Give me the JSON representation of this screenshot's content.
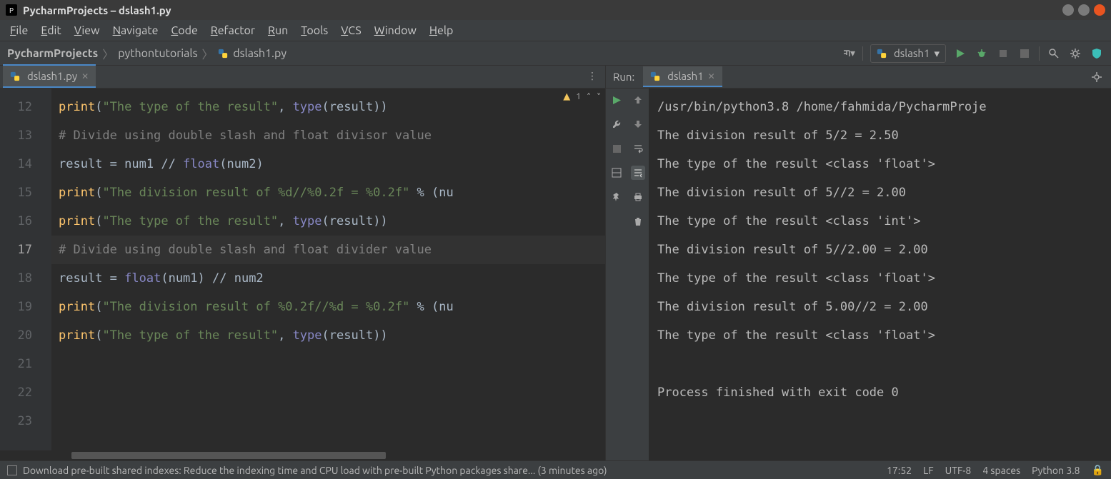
{
  "window": {
    "title": "PycharmProjects – dslash1.py"
  },
  "menu": {
    "items": [
      "File",
      "Edit",
      "View",
      "Navigate",
      "Code",
      "Refactor",
      "Run",
      "Tools",
      "VCS",
      "Window",
      "Help"
    ]
  },
  "breadcrumb": {
    "parts": [
      "PycharmProjects",
      "pythontutorials",
      "dslash1.py"
    ]
  },
  "run_config": {
    "selected": "dslash1"
  },
  "editor": {
    "tab": "dslash1.py",
    "warning_badge": "1",
    "lines": [
      {
        "n": "12",
        "tokens": [
          [
            "fn",
            "print"
          ],
          [
            "op",
            "("
          ],
          [
            "str",
            "\"The type of the result\""
          ],
          [
            "op",
            ", "
          ],
          [
            "builtin",
            "type"
          ],
          [
            "op",
            "("
          ],
          [
            "id",
            "result"
          ],
          [
            "op",
            "))"
          ]
        ]
      },
      {
        "n": "13",
        "tokens": [
          [
            "cmt",
            "# Divide using double slash and float divisor value"
          ]
        ]
      },
      {
        "n": "14",
        "tokens": [
          [
            "id",
            "result "
          ],
          [
            "op",
            "= "
          ],
          [
            "id",
            "num1 "
          ],
          [
            "op",
            "// "
          ],
          [
            "builtin",
            "float"
          ],
          [
            "op",
            "("
          ],
          [
            "id",
            "num2"
          ],
          [
            "op",
            ")"
          ]
        ]
      },
      {
        "n": "15",
        "tokens": [
          [
            "fn",
            "print"
          ],
          [
            "op",
            "("
          ],
          [
            "str",
            "\"The division result of %d//%0.2f = %0.2f\""
          ],
          [
            "op",
            " % ("
          ],
          [
            "id",
            "nu"
          ]
        ]
      },
      {
        "n": "16",
        "tokens": [
          [
            "fn",
            "print"
          ],
          [
            "op",
            "("
          ],
          [
            "str",
            "\"The type of the result\""
          ],
          [
            "op",
            ", "
          ],
          [
            "builtin",
            "type"
          ],
          [
            "op",
            "("
          ],
          [
            "id",
            "result"
          ],
          [
            "op",
            "))"
          ]
        ]
      },
      {
        "n": "17",
        "hl": true,
        "tokens": [
          [
            "cmt",
            "# Divide using double slash and float divider value"
          ]
        ]
      },
      {
        "n": "18",
        "tokens": [
          [
            "id",
            "result "
          ],
          [
            "op",
            "= "
          ],
          [
            "builtin",
            "float"
          ],
          [
            "op",
            "("
          ],
          [
            "id",
            "num1"
          ],
          [
            "op",
            ") // "
          ],
          [
            "id",
            "num2"
          ]
        ]
      },
      {
        "n": "19",
        "tokens": [
          [
            "fn",
            "print"
          ],
          [
            "op",
            "("
          ],
          [
            "str",
            "\"The division result of %0.2f//%d = %0.2f\""
          ],
          [
            "op",
            " % ("
          ],
          [
            "id",
            "nu"
          ]
        ]
      },
      {
        "n": "20",
        "tokens": [
          [
            "fn",
            "print"
          ],
          [
            "op",
            "("
          ],
          [
            "str",
            "\"The type of the result\""
          ],
          [
            "op",
            ", "
          ],
          [
            "builtin",
            "type"
          ],
          [
            "op",
            "("
          ],
          [
            "id",
            "result"
          ],
          [
            "op",
            "))"
          ]
        ]
      },
      {
        "n": "21",
        "tokens": []
      },
      {
        "n": "22",
        "tokens": []
      },
      {
        "n": "23",
        "tokens": []
      }
    ]
  },
  "run": {
    "label": "Run:",
    "tab": "dslash1",
    "output": [
      "/usr/bin/python3.8 /home/fahmida/PycharmProje",
      "The division result of 5/2 = 2.50",
      "The type of the result <class 'float'>",
      "The division result of 5//2 = 2.00",
      "The type of the result <class 'int'>",
      "The division result of 5//2.00 = 2.00",
      "The type of the result <class 'float'>",
      "The division result of 5.00//2 = 2.00",
      "The type of the result <class 'float'>",
      "",
      "Process finished with exit code 0"
    ]
  },
  "status": {
    "message": "Download pre-built shared indexes: Reduce the indexing time and CPU load with pre-built Python packages share... (3 minutes ago)",
    "time": "17:52",
    "line_ending": "LF",
    "encoding": "UTF-8",
    "indent": "4 spaces",
    "python": "Python 3.8"
  }
}
